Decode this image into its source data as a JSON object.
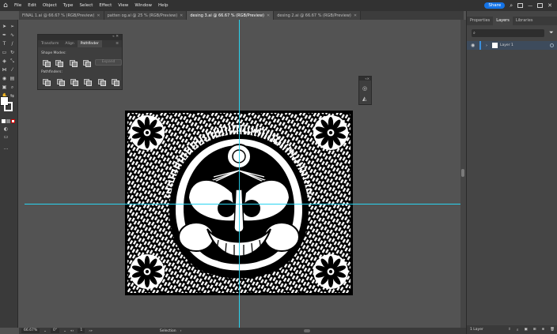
{
  "menubar": {
    "app_icon": "Ai",
    "items": [
      "File",
      "Edit",
      "Object",
      "Type",
      "Select",
      "Effect",
      "View",
      "Window",
      "Help"
    ],
    "share_label": "Share"
  },
  "tabs": [
    {
      "label": "FINAL 1.ai @ 66.67 % (RGB/Preview)",
      "active": false
    },
    {
      "label": "patten og.ai @ 25 % (RGB/Preview)",
      "active": false
    },
    {
      "label": "desing 3.ai @ 66.67 % (RGB/Preview)",
      "active": true
    },
    {
      "label": "desing 2.ai @ 66.67 % (RGB/Preview)",
      "active": false
    }
  ],
  "pathfinder": {
    "tabs": [
      "Transform",
      "Align",
      "Pathfinder"
    ],
    "shape_modes_label": "Shape Modes:",
    "pathfinders_label": "Pathfinders:",
    "expand_label": "Expand"
  },
  "right_panel": {
    "tabs": [
      "Properties",
      "Layers",
      "Libraries"
    ],
    "layer_name": "Layer 1",
    "layer_count": "1 Layer"
  },
  "status": {
    "zoom": "66.67%",
    "rotation": "0°",
    "artboard": "1",
    "tool": "Selection"
  },
  "colors": {
    "guide": "#2ad4f0",
    "accent": "#1473e6"
  },
  "icons": [
    "home-icon",
    "search-icon",
    "filter-icon",
    "eye-icon",
    "close-icon"
  ]
}
